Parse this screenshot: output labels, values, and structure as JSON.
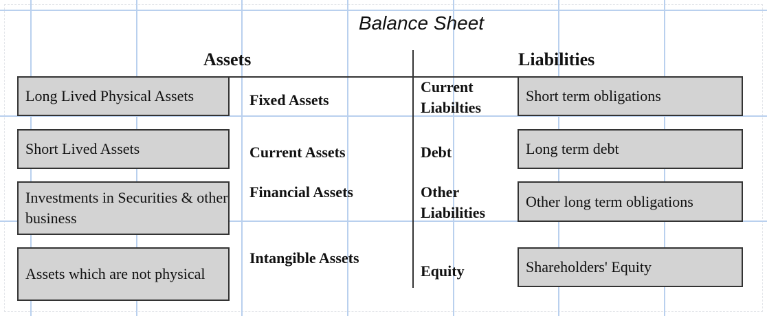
{
  "title": "Balance Sheet",
  "assets_header": "Assets",
  "liabilities_header": "Liabilities",
  "asset_rows": [
    {
      "description": "Long Lived Physical Assets",
      "category": "Fixed Assets"
    },
    {
      "description": "Short Lived Assets",
      "category": "Current Assets"
    },
    {
      "description": "Investments in Securities & other business",
      "category": "Financial Assets"
    },
    {
      "description": "Assets which are not physical",
      "category": "Intangible Assets"
    }
  ],
  "liability_rows": [
    {
      "category": "Current Liabilties",
      "description": "Short term obligations"
    },
    {
      "category": "Debt",
      "description": "Long term debt"
    },
    {
      "category": "Other Liabilities",
      "description": "Other long term obligations"
    },
    {
      "category": "Equity",
      "description": "Shareholders' Equity"
    }
  ],
  "colors": {
    "box_fill": "#d3d3d3",
    "box_border": "#333333",
    "grid": "#b9d0ee"
  }
}
